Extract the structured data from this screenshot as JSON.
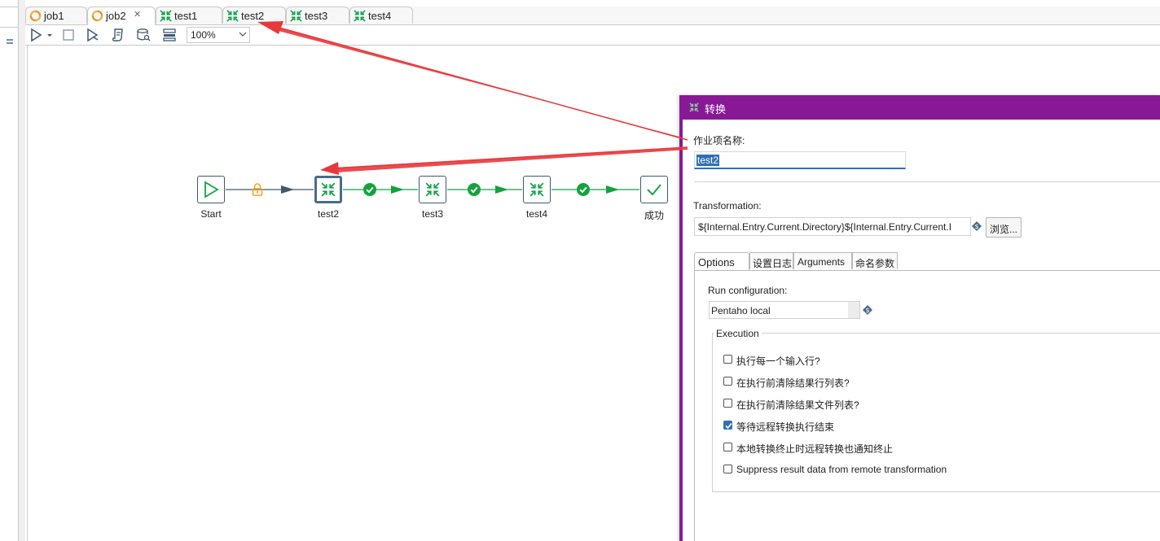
{
  "tabs": [
    {
      "label": "job1",
      "type": "job"
    },
    {
      "label": "job2",
      "type": "job",
      "active": true,
      "closable": true
    },
    {
      "label": "test1",
      "type": "transformation"
    },
    {
      "label": "test2",
      "type": "transformation"
    },
    {
      "label": "test3",
      "type": "transformation"
    },
    {
      "label": "test4",
      "type": "transformation"
    }
  ],
  "toolbar": {
    "icons": [
      "run-icon",
      "run-dropdown-icon",
      "stop-icon",
      "preview-icon",
      "script-icon",
      "sql-icon",
      "layout-icon"
    ],
    "zoom": "100%"
  },
  "canvas": {
    "nodes": [
      {
        "label": "Start",
        "icon": "start-play-icon"
      },
      {
        "label": "test2",
        "icon": "transformation-icon",
        "selected": true
      },
      {
        "label": "test3",
        "icon": "transformation-icon"
      },
      {
        "label": "test4",
        "icon": "transformation-icon"
      },
      {
        "label": "成功",
        "icon": "success-check-icon"
      }
    ],
    "hops": [
      {
        "condition": "unconditional",
        "icon": "lock-icon",
        "color": "#f5a623"
      },
      {
        "condition": "success",
        "icon": "check-circle-icon",
        "color": "#14a33b"
      },
      {
        "condition": "success",
        "icon": "check-circle-icon",
        "color": "#14a33b"
      },
      {
        "condition": "success",
        "icon": "check-circle-icon",
        "color": "#14a33b"
      }
    ]
  },
  "dialog": {
    "title": "转换",
    "title_bar_color": "#881896",
    "job_entry_name_label": "作业项名称:",
    "job_entry_name_value": "test2",
    "transformation_label": "Transformation:",
    "transformation_value": "${Internal.Entry.Current.Directory}${Internal.Entry.Current.I",
    "browse_button": "浏览...",
    "subtabs": [
      "Options",
      "设置日志",
      "Arguments",
      "命名参数"
    ],
    "run_config_label": "Run configuration:",
    "run_config_value": "Pentaho local",
    "execution_group": "Execution",
    "checkboxes": [
      {
        "label": "执行每一个输入行?",
        "checked": false
      },
      {
        "label": "在执行前清除结果行列表?",
        "checked": false
      },
      {
        "label": "在执行前清除结果文件列表?",
        "checked": false
      },
      {
        "label": "等待远程转换执行结束",
        "checked": true
      },
      {
        "label": "本地转换终止时远程转换也通知终止",
        "checked": false
      },
      {
        "label": "Suppress result data from remote transformation",
        "checked": false
      }
    ]
  },
  "annotation_color": "#e8383b"
}
